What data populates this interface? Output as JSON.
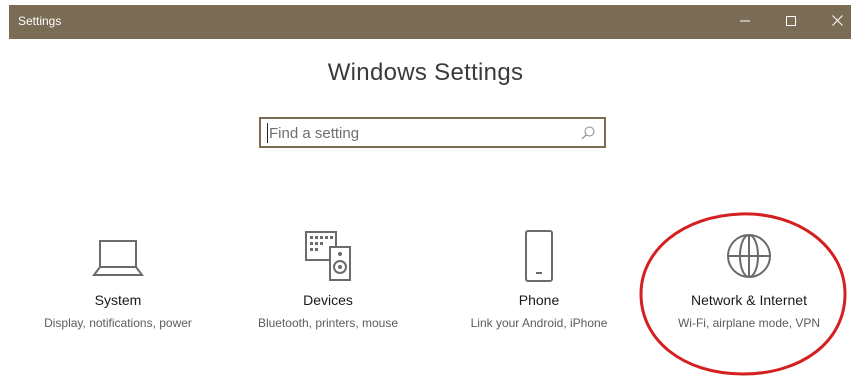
{
  "window": {
    "title": "Settings",
    "minimize_icon": "minimize-icon",
    "maximize_icon": "maximize-icon",
    "close_icon": "close-icon",
    "titlebar_color": "#7a6c55"
  },
  "page": {
    "title": "Windows Settings"
  },
  "search": {
    "placeholder": "Find a setting",
    "value": "",
    "icon": "search-icon"
  },
  "categories": [
    {
      "label": "System",
      "description": "Display, notifications, power",
      "icon": "laptop-icon"
    },
    {
      "label": "Devices",
      "description": "Bluetooth, printers, mouse",
      "icon": "keyboard-speaker-icon"
    },
    {
      "label": "Phone",
      "description": "Link your Android, iPhone",
      "icon": "phone-icon"
    },
    {
      "label": "Network & Internet",
      "description": "Wi-Fi, airplane mode, VPN",
      "icon": "globe-icon"
    }
  ],
  "annotation": {
    "shape": "ellipse",
    "color": "#d42020",
    "highlights": "Network & Internet"
  },
  "colors": {
    "accent": "#7a6c55",
    "icon": "#6b6b6b"
  }
}
